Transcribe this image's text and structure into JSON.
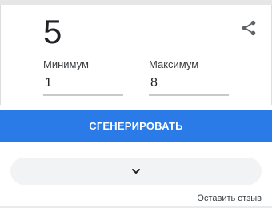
{
  "generator": {
    "result": "5",
    "min_label": "Минимум",
    "min_value": "1",
    "max_label": "Максимум",
    "max_value": "8",
    "generate_label": "СГЕНЕРИРОВАТЬ"
  },
  "footer": {
    "feedback_label": "Оставить отзыв"
  },
  "icons": {
    "share": "share-icon",
    "expand": "chevron-down-icon"
  },
  "colors": {
    "accent": "#2a7be8",
    "expand_bg": "#f1f3f4"
  }
}
